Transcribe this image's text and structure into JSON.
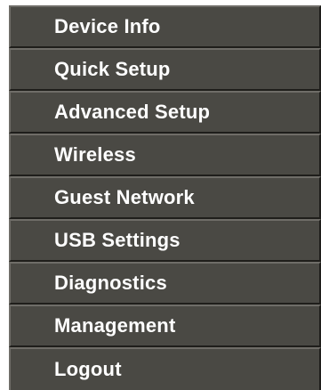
{
  "nav_menu": {
    "items": [
      {
        "label": "Device Info"
      },
      {
        "label": "Quick Setup"
      },
      {
        "label": "Advanced Setup"
      },
      {
        "label": "Wireless"
      },
      {
        "label": "Guest Network"
      },
      {
        "label": "USB Settings"
      },
      {
        "label": "Diagnostics"
      },
      {
        "label": "Management"
      },
      {
        "label": "Logout"
      }
    ]
  },
  "colors": {
    "item_background": "#4a4944",
    "item_text": "#ffffff",
    "item_highlight_edge": "#6f6d68",
    "item_shadow_edge": "#1f1e1b",
    "page_background": "#ffffff"
  }
}
